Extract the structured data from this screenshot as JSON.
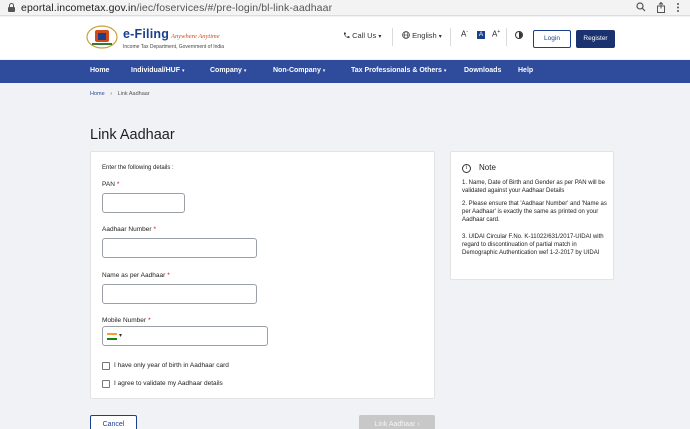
{
  "browser": {
    "url_host": "eportal.incometax.gov.in",
    "url_path": "/iec/foservices/#/pre-login/bl-link-aadhaar",
    "icons": [
      "lock-icon",
      "search-icon",
      "share-icon"
    ]
  },
  "header": {
    "logo_title": "e-Filing",
    "logo_tagline": "Anywhere Anytime",
    "logo_subtitle": "Income Tax Department, Government of India",
    "call_us": "Call Us",
    "language": "English",
    "font_decrease": "A",
    "font_normal": "A",
    "font_increase": "A",
    "login": "Login",
    "register": "Register"
  },
  "nav": {
    "items": [
      "Home",
      "Individual/HUF",
      "Company",
      "Non-Company",
      "Tax Professionals & Others",
      "Downloads",
      "Help"
    ]
  },
  "breadcrumb": {
    "home": "Home",
    "separator": "›",
    "current": "Link Aadhaar"
  },
  "page_title": "Link Aadhaar",
  "form": {
    "intro": "Enter the following details :",
    "pan_label": "PAN",
    "aadhaar_label": "Aadhaar Number",
    "name_label": "Name as per Aadhaar",
    "mobile_label": "Mobile Number",
    "required_mark": "*",
    "country_caret": "▾",
    "checkbox_year_of_birth": "I have only year of birth in Aadhaar card",
    "checkbox_agree": "I agree to validate my Aadhaar details"
  },
  "note": {
    "title": "Note",
    "items": [
      "1. Name, Date of Birth and Gender as per PAN will be validated against your Aadhaar Details",
      "2. Please ensure that 'Aadhaar Number' and 'Name as per Aadhaar' is exactly the same as printed on your Aadhaar card.",
      "3. UIDAI Circular F.No. K-11022/631/2017-UIDAI with regard to discontinuation of partial match in Demographic Authentication wef 1-2-2017 by UIDAI"
    ]
  },
  "buttons": {
    "cancel": "Cancel",
    "link": "Link Aadhaar ›"
  },
  "colors": {
    "nav": "#2e4b9c",
    "brand": "#1b3f8b",
    "register": "#1b3270",
    "disabled": "#c8c8c8",
    "required": "#d0021b"
  }
}
